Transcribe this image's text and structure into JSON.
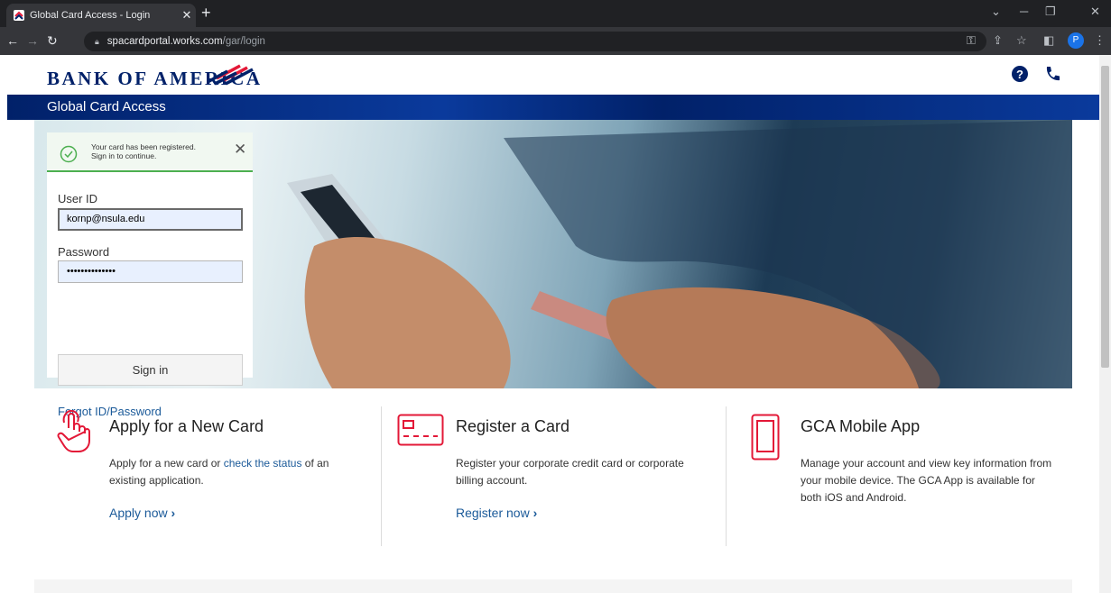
{
  "browser": {
    "tab_title": "Global Card Access - Login",
    "url_host": "spacardportal.works.com",
    "url_path": "/gar/login",
    "profile_initial": "P"
  },
  "header": {
    "logo_text": "BANK OF AMERICA",
    "subtitle": "Global Card Access"
  },
  "colors": {
    "brand_navy": "#012169",
    "brand_red": "#e31837",
    "link_blue": "#1b5a99",
    "success_green": "#4caf50"
  },
  "login": {
    "notice_line1": "Your card has been registered.",
    "notice_line2": "Sign in to continue.",
    "user_id_label": "User ID",
    "user_id_value": "kornp@nsula.edu",
    "password_label": "Password",
    "password_value": "••••••••••••••",
    "sign_in_label": "Sign in",
    "forgot_label": "Forgot ID/Password"
  },
  "features": [
    {
      "title": "Apply for a New Card",
      "desc_before": "Apply for a new card or ",
      "desc_link": "check the status",
      "desc_after": " of an existing application.",
      "link_label": "Apply now",
      "icon": "hand-pointer-icon"
    },
    {
      "title": "Register a Card",
      "desc": "Register your corporate credit card or corporate billing account.",
      "link_label": "Register now",
      "icon": "card-icon"
    },
    {
      "title": "GCA Mobile App",
      "desc": "Manage your account and view key information from your mobile device. The GCA App is available for both iOS and Android.",
      "icon": "mobile-phone-icon"
    }
  ]
}
